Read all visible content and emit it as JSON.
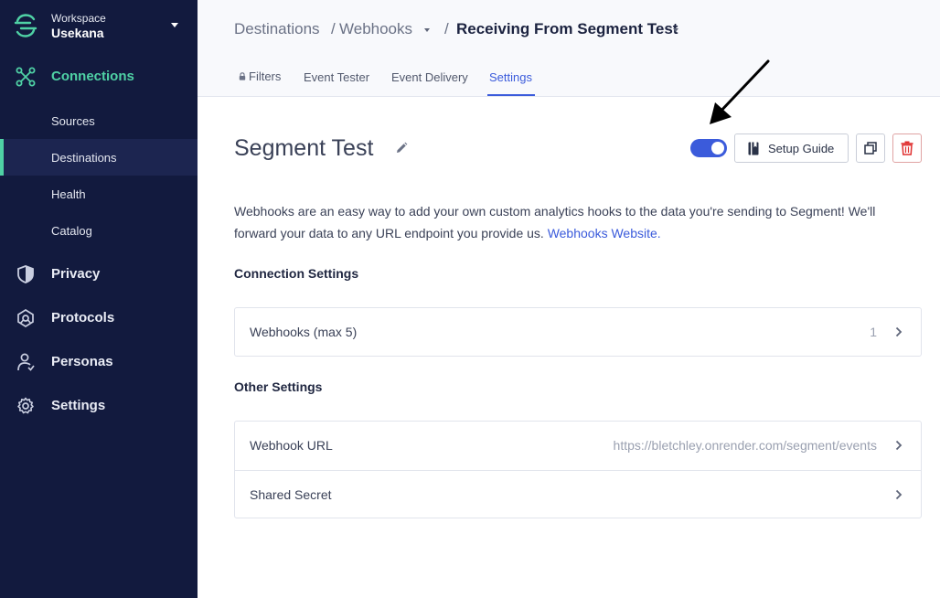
{
  "workspace": {
    "label": "Workspace",
    "name": "Usekana"
  },
  "sidebar": {
    "main_items": [
      {
        "label": "Connections",
        "icon": "connections-icon",
        "active": true
      },
      {
        "label": "Privacy",
        "icon": "shield-icon"
      },
      {
        "label": "Protocols",
        "icon": "protocols-icon"
      },
      {
        "label": "Personas",
        "icon": "personas-icon"
      },
      {
        "label": "Settings",
        "icon": "gear-icon"
      }
    ],
    "sub_items": [
      {
        "label": "Sources"
      },
      {
        "label": "Destinations",
        "active": true
      },
      {
        "label": "Health"
      },
      {
        "label": "Catalog"
      }
    ]
  },
  "breadcrumb": {
    "items": [
      "Destinations",
      "Webhooks",
      "Receiving From Segment Test"
    ],
    "separator": "/"
  },
  "tabs": [
    {
      "label": "Filters",
      "locked": true
    },
    {
      "label": "Event Tester"
    },
    {
      "label": "Event Delivery"
    },
    {
      "label": "Settings",
      "active": true
    }
  ],
  "page": {
    "title": "Segment Test",
    "enabled": true,
    "setup_guide_label": "Setup Guide",
    "description": "Webhooks are an easy way to add your own custom analytics hooks to the data you're sending to Segment! We'll forward your data to any URL endpoint you provide us.",
    "description_link": "Webhooks Website."
  },
  "connection_settings": {
    "title": "Connection Settings",
    "rows": [
      {
        "label": "Webhooks (max 5)",
        "value": "1"
      }
    ]
  },
  "other_settings": {
    "title": "Other Settings",
    "rows": [
      {
        "label": "Webhook URL",
        "value": "https://bletchley.onrender.com/segment/events"
      },
      {
        "label": "Shared Secret",
        "value": ""
      }
    ]
  },
  "colors": {
    "sidebar_bg": "#121a3e",
    "accent_green": "#4fd1a5",
    "primary_blue": "#3b5bdb",
    "danger": "#e03131"
  }
}
